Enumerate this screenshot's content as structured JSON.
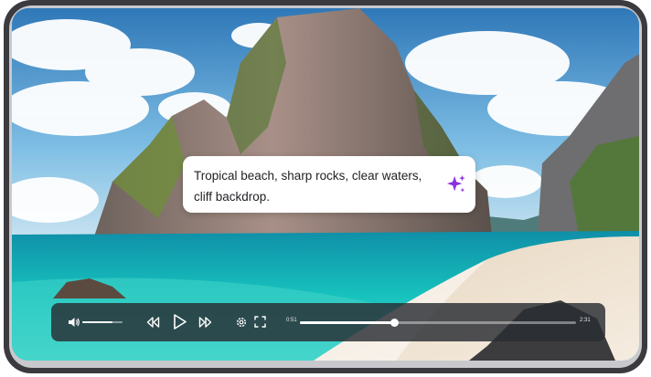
{
  "caption": {
    "line1": "Tropical beach, sharp rocks, clear waters,",
    "line2": "cliff backdrop."
  },
  "player": {
    "current_time": "0:51",
    "duration": "2:31",
    "progress": 0.34,
    "volume": 0.75,
    "icons": {
      "volume": "volume-icon",
      "rewind": "rewind-icon",
      "play": "play-icon",
      "forward": "fast-forward-icon",
      "settings": "gear-icon",
      "fullscreen": "fullscreen-icon",
      "ai": "sparkle-icon"
    }
  },
  "colors": {
    "sparkle": "#8b2fe0",
    "frame": "#3a3a3f",
    "water": "#19c3c0",
    "sand": "#efe2cf"
  }
}
